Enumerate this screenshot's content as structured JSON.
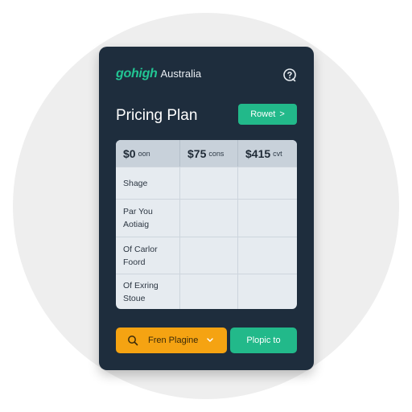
{
  "app": {
    "brand": "gohigh",
    "brand_suffix": "Australia",
    "help_icon": "help-circle-icon"
  },
  "header": {
    "title": "Pricing Plan",
    "reset_label": "Rowet",
    "reset_chevron": ">"
  },
  "table": {
    "columns": [
      {
        "price": "$0",
        "unit": "oon"
      },
      {
        "price": "$75",
        "unit": "cons"
      },
      {
        "price": "$415",
        "unit": "cvt"
      }
    ],
    "rows": [
      {
        "label": "Shage"
      },
      {
        "label": "Par You\nAotiaig"
      },
      {
        "label": "Of Carlor\nFoord"
      },
      {
        "label": "Of Exring\nStoue"
      }
    ]
  },
  "footer": {
    "left_label": "Fren Plagine",
    "left_icon": "search-icon",
    "left_chevron": "chevron-down-icon",
    "right_label": "Plopic to"
  },
  "colors": {
    "card_bg": "#1e2d3d",
    "accent_green": "#22b98a",
    "accent_orange": "#f5a312",
    "table_bg": "#e6ebf0",
    "table_header_bg": "#c8d1da"
  }
}
